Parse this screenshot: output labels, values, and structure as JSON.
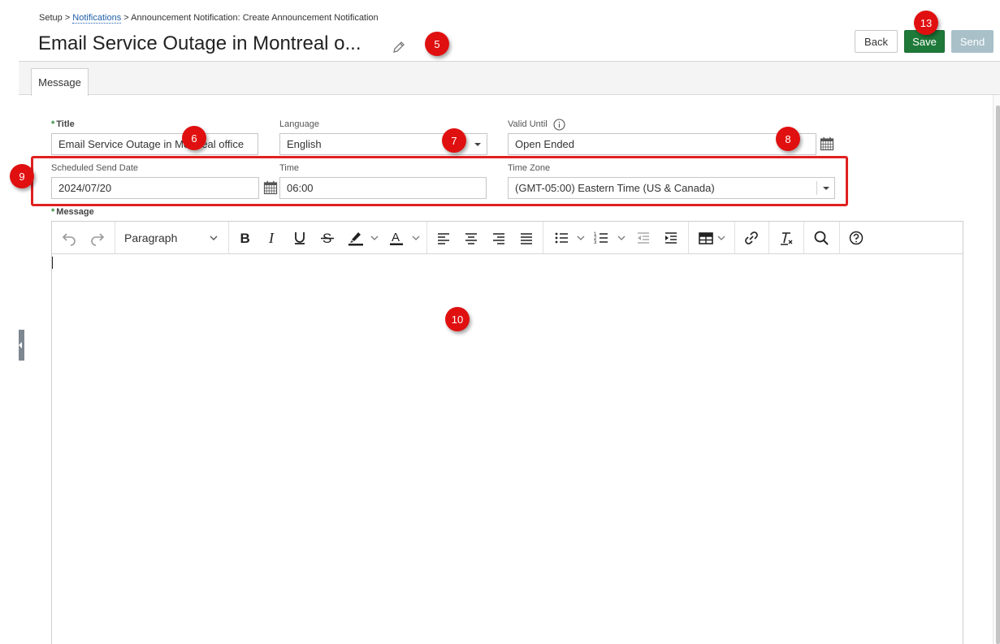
{
  "breadcrumb": {
    "setup": "Setup",
    "sep1": " > ",
    "notifications": "Notifications",
    "sep2": " > ",
    "current": "Announcement Notification: Create Announcement Notification"
  },
  "header": {
    "title": "Email Service Outage in Montreal o...",
    "back_label": "Back",
    "save_label": "Save",
    "send_label": "Send"
  },
  "tabs": [
    {
      "label": "Message",
      "active": true
    }
  ],
  "form": {
    "title_label": "Title",
    "title_value": "Email Service Outage in Montreal office",
    "language_label": "Language",
    "language_value": "English",
    "valid_until_label": "Valid Until",
    "valid_until_value": "Open Ended",
    "scheduled_send_date_label": "Scheduled Send Date",
    "scheduled_send_date_value": "2024/07/20",
    "time_label": "Time",
    "time_value": "06:00",
    "time_zone_label": "Time Zone",
    "time_zone_value": "(GMT-05:00) Eastern Time (US & Canada)",
    "message_label": "Message",
    "required_mark": "*"
  },
  "editor": {
    "paragraph_label": "Paragraph",
    "content": ""
  },
  "annotations": {
    "m5": "5",
    "m6": "6",
    "m7": "7",
    "m8": "8",
    "m9": "9",
    "m10": "10",
    "m13": "13"
  },
  "colors": {
    "save_button": "#1f7a3a",
    "send_button_disabled": "#a9c0c9",
    "link": "#1f5fa8",
    "marker": "#e01010",
    "highlight_box": "#e02020",
    "required": "#2e8b3a"
  }
}
